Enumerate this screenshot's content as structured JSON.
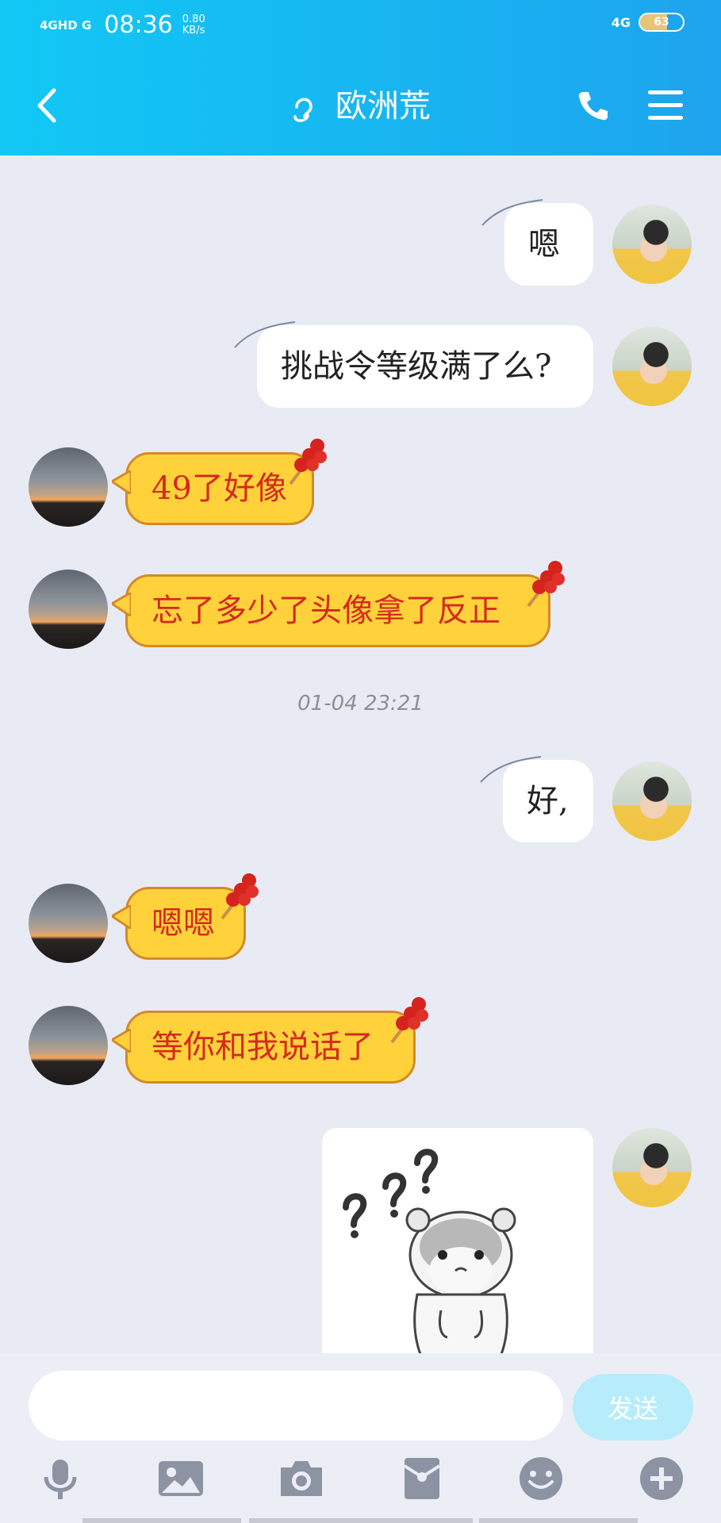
{
  "status_bar": {
    "signal_left": "4GHD G",
    "time": "08:36",
    "speed": "0.80",
    "speed_unit": "KB/s",
    "network": "4G",
    "battery": "63",
    "battery_level": 0.63
  },
  "header": {
    "title": "欧洲荒",
    "colors": {
      "start": "#12c8f5",
      "end": "#1ea4ee"
    }
  },
  "messages": [
    {
      "side": "me",
      "text": "嗯"
    },
    {
      "side": "me",
      "text": "挑战令等级满了么?"
    },
    {
      "side": "other",
      "text": "49了好像"
    },
    {
      "side": "other",
      "text": "忘了多少了头像拿了反正"
    },
    {
      "side": "timestamp",
      "text": "01-04 23:21"
    },
    {
      "side": "me",
      "text": "好,"
    },
    {
      "side": "other",
      "text": "嗯嗯"
    },
    {
      "side": "other",
      "text": "等你和我说话了"
    },
    {
      "side": "me",
      "type": "sticker",
      "icon": "hamster-question-sticker"
    }
  ],
  "input": {
    "placeholder": "",
    "send_label": "发送"
  },
  "toolbar": {
    "items": [
      "microphone-icon",
      "image-icon",
      "camera-icon",
      "red-packet-icon",
      "emoji-icon",
      "plus-icon"
    ]
  },
  "colors": {
    "background": "#e9ebf4",
    "other_bubble": "#ffd23b",
    "other_text": "#d42a1b",
    "send_button": "#b7ecfa"
  }
}
